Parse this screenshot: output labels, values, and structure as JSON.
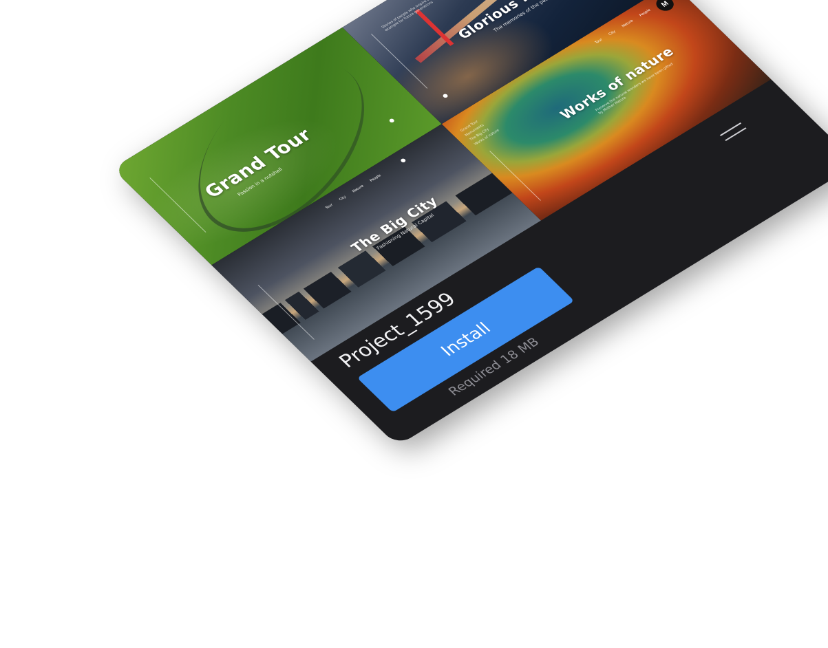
{
  "tiles": [
    {
      "title": "Grand Tour",
      "subtitle": "Passion in a nutshell"
    },
    {
      "title": "Glorious Monuments",
      "subtitle": "The memories of the past",
      "blurb": "Stories of people who inspire and set an example for future generations"
    },
    {
      "title": "The Big City",
      "subtitle": "Fashioning Natural Capital",
      "nav": [
        "Tour",
        "City",
        "Nature",
        "People"
      ]
    },
    {
      "title": "Works of nature",
      "subtitle": "Preserve the natural wonders we have been gifted by Mother Nature",
      "nav": [
        "Tour",
        "City",
        "Nature",
        "People"
      ],
      "menu": [
        "Grand Tour",
        "Monuments",
        "The Big City",
        "Works of nature"
      ],
      "logo": "M"
    }
  ],
  "app": {
    "name": "Project_1599",
    "install_label": "Install",
    "required_text": "Required 18 MB"
  },
  "colors": {
    "card_bg": "#1c1c1f",
    "accent": "#3d8ef0"
  }
}
